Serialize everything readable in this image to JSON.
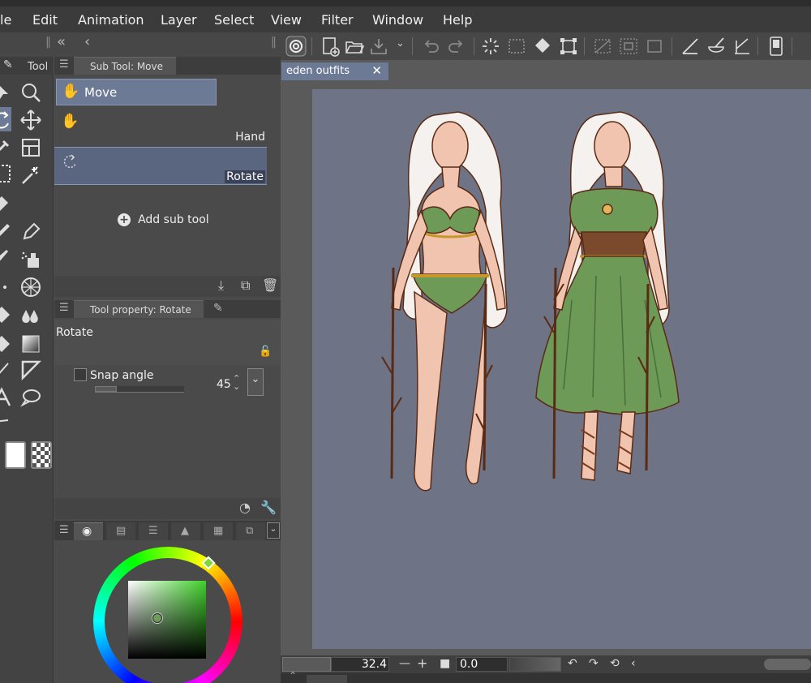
{
  "menu": {
    "items": [
      "le",
      "Edit",
      "Animation",
      "Layer",
      "Select",
      "View",
      "Filter",
      "Window",
      "Help"
    ]
  },
  "left_panel": {
    "tool_tab": "Tool",
    "subtool_tab": "Sub Tool: Move",
    "move_group": "Move",
    "hand": "Hand",
    "rotate": "Rotate",
    "add_subtool": "Add sub tool",
    "toolprop_tab": "Tool property: Rotate",
    "toolprop_title": "Rotate",
    "snap_label": "Snap angle",
    "snap_value": "45"
  },
  "document": {
    "tab": "eden outfits"
  },
  "status": {
    "zoom": "32.4",
    "angle": "0.0"
  },
  "colors": {
    "accent": "#6d7a96",
    "current_color": "#5f8a52",
    "canvas_bg": "#6e7486",
    "selected_item": "#5a6580"
  },
  "icons": [
    "move-icon",
    "zoom-icon",
    "rotate-icon",
    "pan-icon",
    "eyedropper-icon",
    "layer-icon",
    "select-icon",
    "magic-wand-icon",
    "pen-icon",
    "airbrush-icon",
    "grid-icon",
    "fill-icon",
    "gradient-icon",
    "text-icon",
    "balloon-icon",
    "undo-icon",
    "redo-icon"
  ]
}
